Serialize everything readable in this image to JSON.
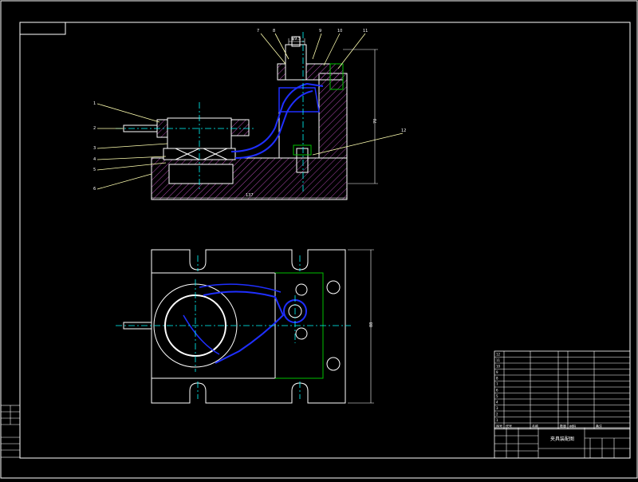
{
  "colors": {
    "background": "#000000",
    "frame": "#ffffff",
    "outline": "#ffffff",
    "center_line": "#00ffff",
    "hidden_part": "#1f2fff",
    "hatch": "#b04ab0",
    "green_part": "#00c000",
    "dimension": "#ffffff",
    "leader": "#ffffb0",
    "title_block": "#ffffff"
  },
  "front_view": {
    "part_numbers": [
      "7",
      "8",
      "9",
      "10",
      "11",
      "1",
      "2",
      "3",
      "4",
      "5",
      "6",
      "12"
    ],
    "dim_top": "φ9.5",
    "dim_height": "70",
    "dim_width": "137"
  },
  "top_view": {
    "dim_height": "88"
  },
  "title_block": {
    "title": "夹具装配图",
    "bom_header": [
      "序号",
      "代号",
      "名称",
      "数量",
      "材料",
      "备注"
    ],
    "bom_rows": [
      [
        "12",
        "",
        "",
        "",
        "",
        ""
      ],
      [
        "11",
        "",
        "",
        "",
        "",
        ""
      ],
      [
        "10",
        "",
        "",
        "",
        "",
        ""
      ],
      [
        "9",
        "",
        "",
        "",
        "",
        ""
      ],
      [
        "8",
        "",
        "",
        "",
        "",
        ""
      ],
      [
        "7",
        "",
        "",
        "",
        "",
        ""
      ],
      [
        "6",
        "",
        "",
        "",
        "",
        ""
      ],
      [
        "5",
        "",
        "",
        "",
        "",
        ""
      ],
      [
        "4",
        "",
        "",
        "",
        "",
        ""
      ],
      [
        "3",
        "",
        "",
        "",
        "",
        ""
      ],
      [
        "2",
        "",
        "",
        "",
        "",
        ""
      ],
      [
        "1",
        "",
        "",
        "",
        "",
        ""
      ]
    ]
  }
}
